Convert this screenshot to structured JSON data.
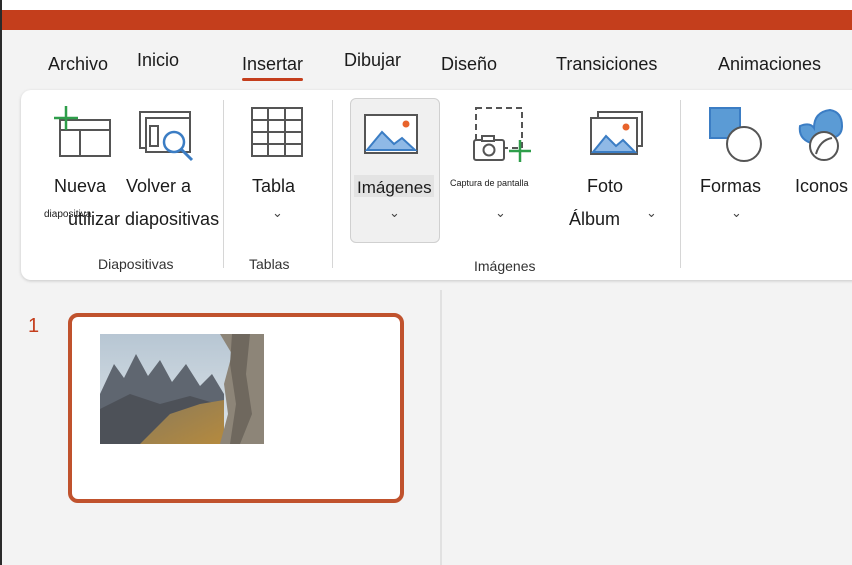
{
  "colors": {
    "accent": "#c43e1c",
    "thumb_border": "#c0522d",
    "icon_blue": "#3b7dc4",
    "icon_green": "#2e9e4a"
  },
  "menu": {
    "tabs": [
      {
        "label": "Archivo",
        "active": false
      },
      {
        "label": "Inicio",
        "active": false
      },
      {
        "label": "Insertar",
        "active": true
      },
      {
        "label": "Dibujar",
        "active": false
      },
      {
        "label": "Diseño",
        "active": false
      },
      {
        "label": "Transiciones",
        "active": false
      },
      {
        "label": "Animaciones",
        "active": false
      }
    ]
  },
  "ribbon": {
    "nueva": {
      "line1": "Nueva",
      "line2": "diapositiva",
      "icon": "new-slide-icon"
    },
    "volver": {
      "line1": "Volver a",
      "line2": "utilizar diapositivas",
      "icon": "reuse-slides-icon"
    },
    "tabla": {
      "label": "Tabla",
      "icon": "table-icon"
    },
    "imagenes": {
      "label": "Imágenes",
      "icon": "pictures-icon"
    },
    "captura": {
      "label": "Captura de pantalla",
      "icon": "screenshot-icon"
    },
    "foto": {
      "line1": "Foto",
      "line2": "Álbum",
      "icon": "photo-album-icon"
    },
    "formas": {
      "label": "Formas",
      "icon": "shapes-icon"
    },
    "iconos": {
      "label": "Iconos",
      "icon": "icons-icon"
    },
    "groups": {
      "diapositivas": "Diapositivas",
      "tablas": "Tablas",
      "imagenes": "Imágenes"
    }
  },
  "slides": [
    {
      "number": "1",
      "image": "mountain-landscape-image"
    }
  ]
}
